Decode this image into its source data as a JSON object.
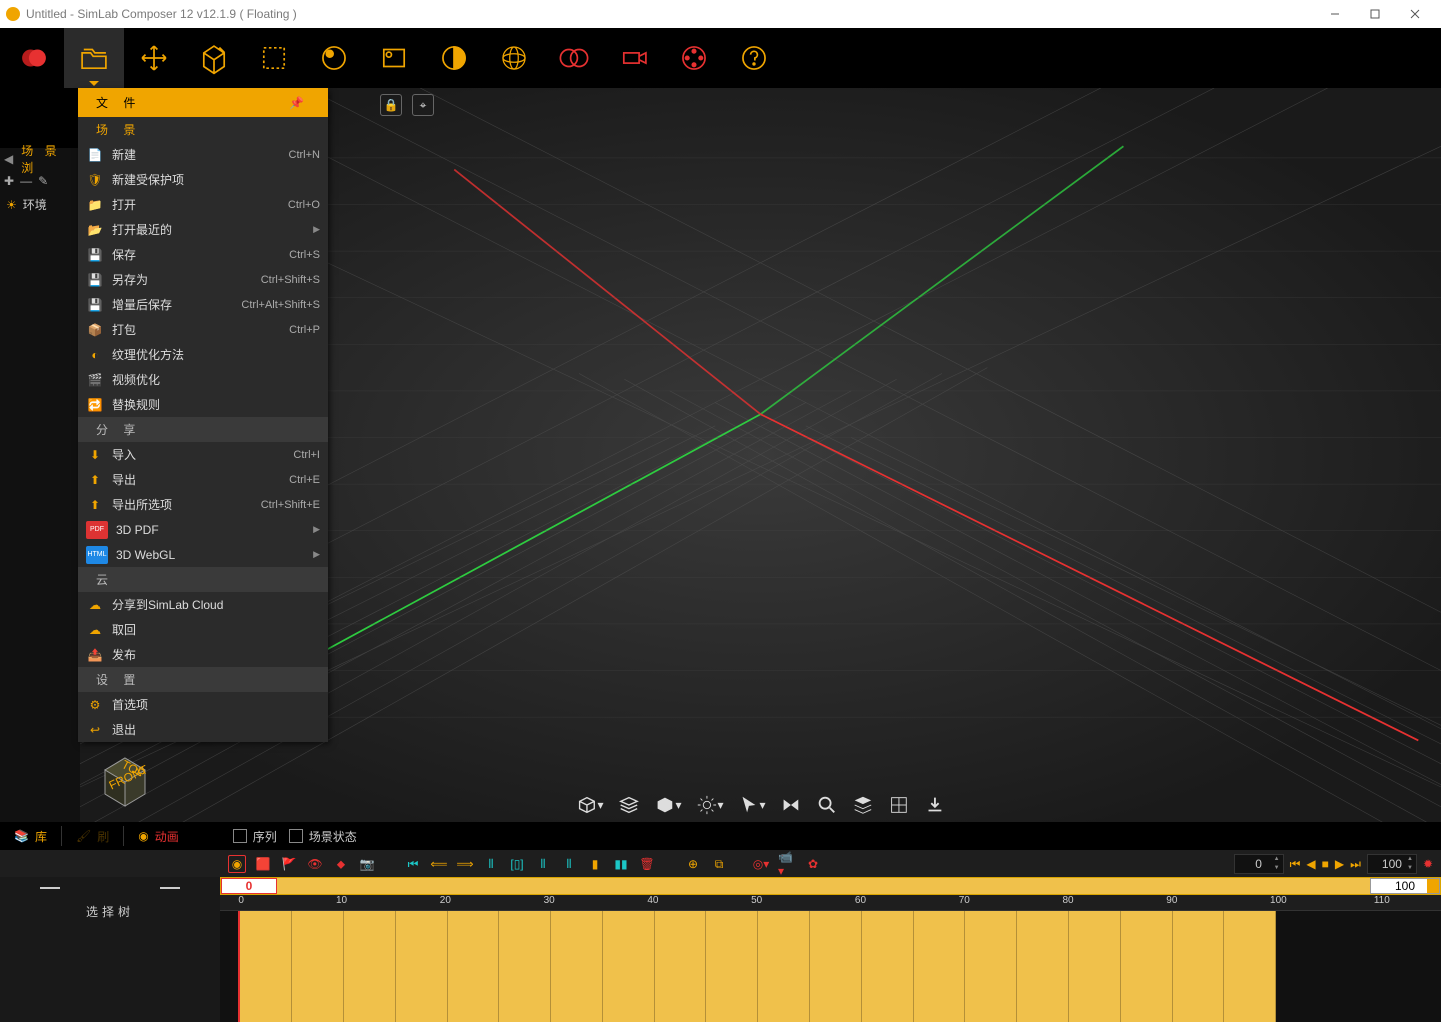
{
  "titlebar": {
    "title": "Untitled - SimLab Composer 12 v12.1.9 ( Floating )"
  },
  "leftpanel": {
    "header": "场 景 浏",
    "env": "环境"
  },
  "filemenu": {
    "title": "文 件",
    "sections": {
      "scene": "场 景",
      "share": "分 享",
      "cloud": "云",
      "settings": "设 置"
    },
    "items": {
      "new": {
        "label": "新建",
        "sc": "Ctrl+N"
      },
      "newProtected": {
        "label": "新建受保护项",
        "sc": ""
      },
      "open": {
        "label": "打开",
        "sc": "Ctrl+O"
      },
      "openRecent": {
        "label": "打开最近的",
        "sc": ""
      },
      "save": {
        "label": "保存",
        "sc": "Ctrl+S"
      },
      "saveAs": {
        "label": "另存为",
        "sc": "Ctrl+Shift+S"
      },
      "saveInc": {
        "label": "增量后保存",
        "sc": "Ctrl+Alt+Shift+S"
      },
      "pack": {
        "label": "打包",
        "sc": "Ctrl+P"
      },
      "texOpt": {
        "label": "纹理优化方法",
        "sc": ""
      },
      "vidOpt": {
        "label": "视频优化",
        "sc": ""
      },
      "replace": {
        "label": "替换规则",
        "sc": ""
      },
      "import": {
        "label": "导入",
        "sc": "Ctrl+I"
      },
      "export": {
        "label": "导出",
        "sc": "Ctrl+E"
      },
      "exportAll": {
        "label": "导出所选项",
        "sc": "Ctrl+Shift+E"
      },
      "pdf": {
        "label": "3D PDF",
        "sc": ""
      },
      "webgl": {
        "label": "3D WebGL",
        "sc": ""
      },
      "shareCloud": {
        "label": "分享到SimLab Cloud",
        "sc": ""
      },
      "retrieve": {
        "label": "取回",
        "sc": ""
      },
      "publish": {
        "label": "发布",
        "sc": ""
      },
      "prefs": {
        "label": "首选项",
        "sc": ""
      },
      "exit": {
        "label": "退出",
        "sc": ""
      }
    }
  },
  "bottomtabs": {
    "lib": "库",
    "brush": "刷",
    "anim": "动画",
    "seq": "序列",
    "sceneState": "场景状态"
  },
  "timeline": {
    "treeTitle": "选择树",
    "startFrame": "0",
    "endFrame": "100",
    "controls": {
      "left": "0",
      "right": "100"
    },
    "ticks": [
      "0",
      "10",
      "20",
      "30",
      "40",
      "50",
      "60",
      "70",
      "80",
      "90",
      "100",
      "110"
    ]
  }
}
